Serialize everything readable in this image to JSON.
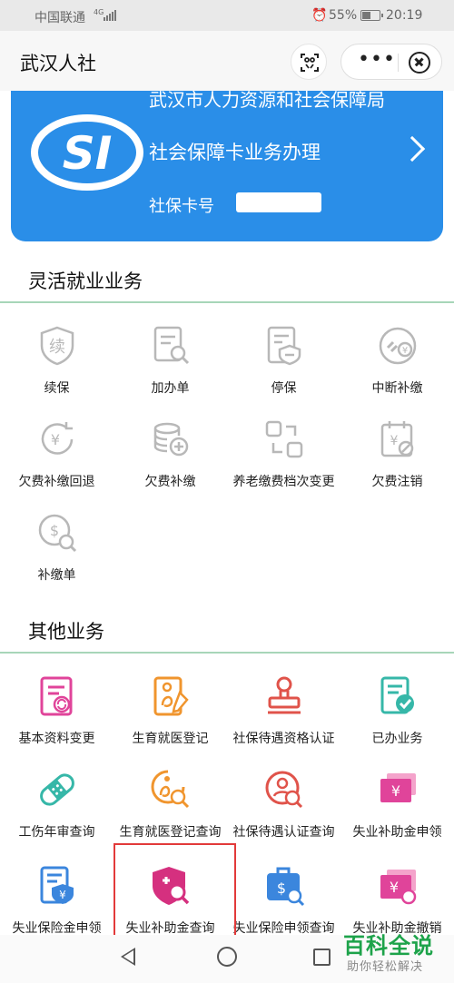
{
  "status_bar": {
    "carrier": "中国联通",
    "signal_tag": "4G",
    "battery": "55%",
    "battery_level": 0.55,
    "time": "20:19"
  },
  "navbar": {
    "title": "武汉人社",
    "more_label": "•••"
  },
  "banner": {
    "agency": "武汉市人力资源和社会保障局",
    "service": "社会保障卡业务办理",
    "card_label": "社保卡号",
    "logo_text": "SI",
    "color": "#2a8ee8"
  },
  "sections": {
    "flexible": {
      "title": "灵活就业业务",
      "items": [
        {
          "label": "续保",
          "icon": "renew-icon"
        },
        {
          "label": "加办单",
          "icon": "add-form-icon"
        },
        {
          "label": "停保",
          "icon": "stop-insurance-icon"
        },
        {
          "label": "中断补缴",
          "icon": "interrupt-payment-icon"
        },
        {
          "label": "欠费补缴回退",
          "icon": "arrears-refund-icon"
        },
        {
          "label": "欠费补缴",
          "icon": "arrears-payment-icon"
        },
        {
          "label": "养老缴费档次变更",
          "icon": "pension-level-change-icon"
        },
        {
          "label": "欠费注销",
          "icon": "arrears-cancel-icon"
        },
        {
          "label": "补缴单",
          "icon": "payment-slip-icon"
        }
      ]
    },
    "other": {
      "title": "其他业务",
      "items": [
        {
          "label": "基本资料变更",
          "icon": "profile-change-icon"
        },
        {
          "label": "生育就医登记",
          "icon": "maternity-register-icon"
        },
        {
          "label": "社保待遇资格认证",
          "icon": "qualification-stamp-icon"
        },
        {
          "label": "已办业务",
          "icon": "done-business-icon"
        },
        {
          "label": "工伤年审查询",
          "icon": "injury-review-icon"
        },
        {
          "label": "生育就医登记查询",
          "icon": "maternity-query-icon"
        },
        {
          "label": "社保待遇认证查询",
          "icon": "certification-query-icon"
        },
        {
          "label": "失业补助金申领",
          "icon": "unemployment-subsidy-apply-icon"
        },
        {
          "label": "失业保险金申领",
          "icon": "unemployment-insurance-apply-icon"
        },
        {
          "label": "失业补助金查询",
          "icon": "unemployment-subsidy-query-icon"
        },
        {
          "label": "失业保险申领查询",
          "icon": "unemployment-insurance-query-icon"
        },
        {
          "label": "失业补助金撤销",
          "icon": "unemployment-subsidy-revoke-icon"
        }
      ]
    }
  },
  "watermark": {
    "brand": "百科全说",
    "slogan": "助你轻松解决"
  },
  "colors": {
    "section_line": "#a7d6b8",
    "highlight": "#e23a3a",
    "gray_icon": "#b8b8b8",
    "pink": "#e0449a",
    "orange": "#f0952e",
    "red": "#e0534a",
    "teal": "#36b7a8",
    "blue": "#3b86dd"
  }
}
